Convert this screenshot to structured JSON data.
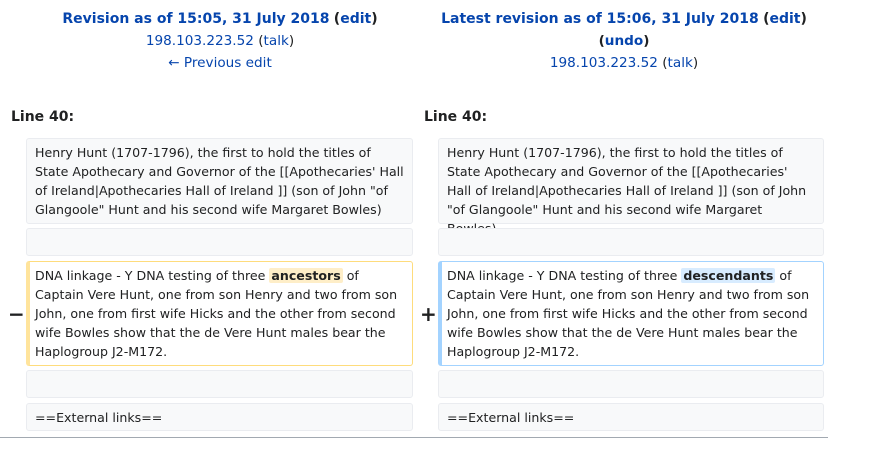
{
  "left_header": {
    "title_prefix": "Revision as of 15:05, 31 July 2018",
    "edit_label": "edit",
    "user": "198.103.223.52",
    "talk_label": "talk",
    "prev_edit": "← Previous edit"
  },
  "right_header": {
    "title_prefix": "Latest revision as of 15:06, 31 July 2018",
    "edit_label": "edit",
    "undo_label": "undo",
    "user": "198.103.223.52",
    "talk_label": "talk"
  },
  "line_left": "Line 40:",
  "line_right": "Line 40:",
  "context_text": "Henry Hunt (1707-1796), the first to hold the titles of State Apothecary and Governor of the [[Apothecaries' Hall of Ireland|Apothecaries Hall of Ireland ]] (son of John \"of Glangoole\" Hunt and his second wife Margaret Bowles)",
  "diff": {
    "minus_marker": "−",
    "plus_marker": "+",
    "before_word": "DNA linkage  - Y DNA testing of three ",
    "deleted_word": "ancestors",
    "added_word": "descendants",
    "after_word": " of Captain Vere Hunt, one from son Henry and two from son John, one from first wife Hicks and the other from second wife Bowles show that the de Vere Hunt males bear the Haplogroup J2-M172."
  },
  "external_links": "==External links=="
}
